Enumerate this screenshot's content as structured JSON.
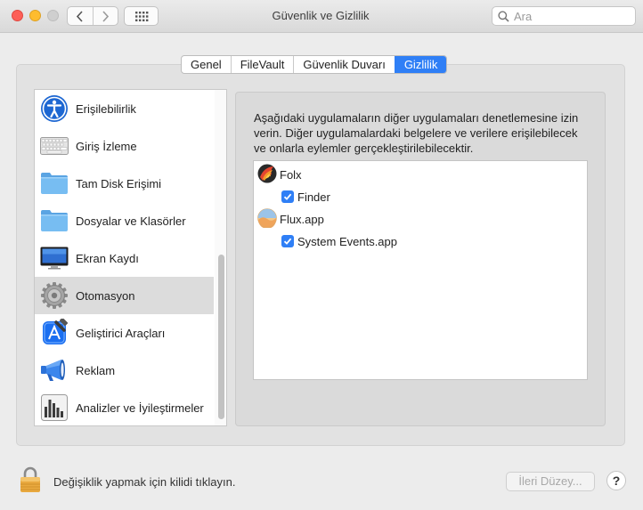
{
  "window": {
    "title": "Güvenlik ve Gizlilik"
  },
  "toolbar": {
    "back_icon": "chevron-left-icon",
    "forward_icon": "chevron-right-icon",
    "grid_icon": "grid-icon"
  },
  "search": {
    "placeholder": "Ara"
  },
  "tabs": [
    {
      "label": "Genel",
      "active": false
    },
    {
      "label": "FileVault",
      "active": false
    },
    {
      "label": "Güvenlik Duvarı",
      "active": false
    },
    {
      "label": "Gizlilik",
      "active": true
    }
  ],
  "sidebar": {
    "items": [
      {
        "label": "Erişilebilirlik",
        "icon": "accessibility-icon"
      },
      {
        "label": "Giriş İzleme",
        "icon": "keyboard-icon"
      },
      {
        "label": "Tam Disk Erişimi",
        "icon": "folder-icon"
      },
      {
        "label": "Dosyalar ve Klasörler",
        "icon": "folder-icon"
      },
      {
        "label": "Ekran Kaydı",
        "icon": "display-icon"
      },
      {
        "label": "Otomasyon",
        "icon": "gear-icon",
        "selected": true
      },
      {
        "label": "Geliştirici Araçları",
        "icon": "xcode-icon"
      },
      {
        "label": "Reklam",
        "icon": "megaphone-icon"
      },
      {
        "label": "Analizler ve İyileştirmeler",
        "icon": "bar-chart-icon"
      }
    ]
  },
  "detail": {
    "description": "Aşağıdaki uygulamaların diğer uygulamaları denetlemesine izin verin. Diğer uygulamalardaki belgelere ve verilere erişilebilecek ve onlarla eylemler gerçekleştirilebilecektir.",
    "apps": [
      {
        "name": "Folx",
        "icon": "folx-app-icon",
        "children": [
          {
            "label": "Finder",
            "checked": true
          }
        ]
      },
      {
        "name": "Flux.app",
        "icon": "flux-app-icon",
        "children": [
          {
            "label": "System Events.app",
            "checked": true
          }
        ]
      }
    ]
  },
  "footer": {
    "lock_text": "Değişiklik yapmak için kilidi tıklayın.",
    "advanced_label": "İleri Düzey...",
    "help_label": "?"
  },
  "colors": {
    "accent": "#2f7ff6",
    "close": "#fd5f57",
    "minimize": "#febc2e"
  }
}
